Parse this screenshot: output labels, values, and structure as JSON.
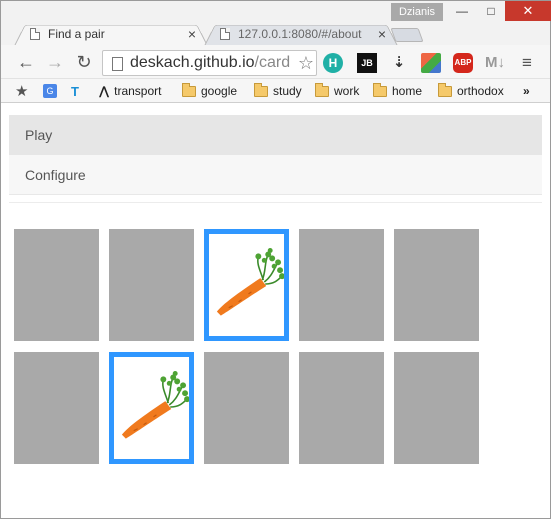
{
  "browser": {
    "profile": "Dzianis",
    "window_buttons": {
      "minimize": "—",
      "maximize": "□",
      "close": "✕"
    },
    "tabs": [
      {
        "title": "Find a pair",
        "close": "×",
        "active": true
      },
      {
        "title": "127.0.0.1:8080/#/about",
        "close": "×",
        "active": false
      }
    ],
    "nav": {
      "back": "←",
      "forward": "→",
      "reload": "↻"
    },
    "address": {
      "host": "deskach.github.io",
      "path": "/cardm",
      "bookmark_star": "☆"
    },
    "extensions": [
      {
        "name": "h-extension-icon",
        "label": "H"
      },
      {
        "name": "jb-extension-icon",
        "label": "JB"
      },
      {
        "name": "download-extension-icon",
        "label": "⇣"
      },
      {
        "name": "multicolor-extension-icon",
        "label": ""
      },
      {
        "name": "adblock-icon",
        "label": "ABP"
      },
      {
        "name": "markdown-extension-icon",
        "label": "M↓"
      }
    ],
    "menu": "≡",
    "bookmarks": [
      "transport",
      "google",
      "study",
      "work",
      "home",
      "orthodox"
    ],
    "bookmarks_overflow": "»"
  },
  "app": {
    "menu": {
      "play": "Play",
      "configure": "Configure"
    },
    "cards": [
      {
        "state": "hidden"
      },
      {
        "state": "hidden"
      },
      {
        "state": "open",
        "image": "carrot"
      },
      {
        "state": "hidden"
      },
      {
        "state": "hidden"
      },
      {
        "state": "hidden"
      },
      {
        "state": "open",
        "image": "carrot"
      },
      {
        "state": "hidden"
      },
      {
        "state": "hidden"
      },
      {
        "state": "hidden"
      }
    ]
  },
  "colors": {
    "card_back": "#a9a9a9",
    "card_selected_border": "#2f97ff",
    "carrot_orange": "#f07a1e",
    "carrot_green": "#3a8a2a"
  }
}
